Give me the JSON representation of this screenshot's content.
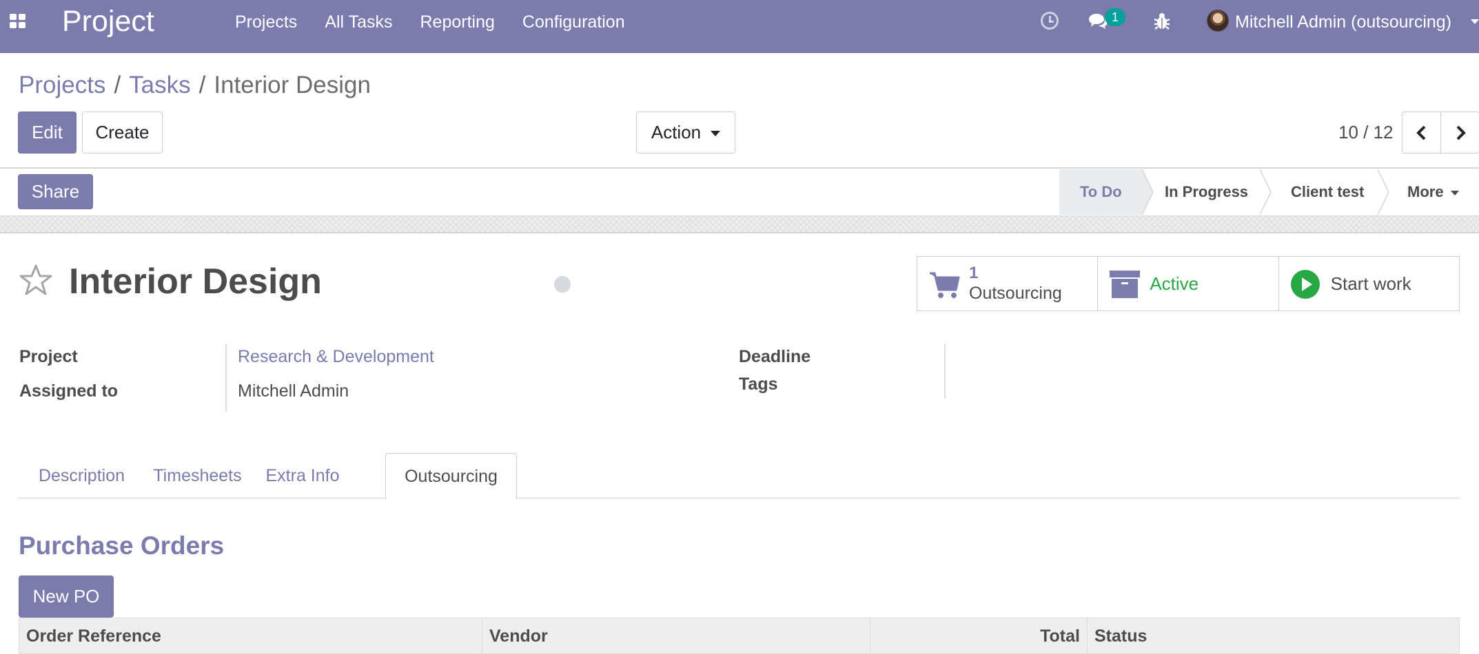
{
  "navbar": {
    "brand": "Project",
    "menu": [
      "Projects",
      "All Tasks",
      "Reporting",
      "Configuration"
    ],
    "chat_count": "1",
    "user": "Mitchell Admin (outsourcing)",
    "icons": [
      "apps-icon",
      "clock-icon",
      "chat-icon",
      "bug-icon",
      "avatar",
      "chevron-down-icon"
    ]
  },
  "breadcrumb": {
    "items": [
      "Projects",
      "Tasks"
    ],
    "current": "Interior Design",
    "separator": "/"
  },
  "toolbar": {
    "edit": "Edit",
    "create": "Create",
    "action": "Action"
  },
  "pager": {
    "value": "10 / 12"
  },
  "statusbar": {
    "share": "Share",
    "stages": [
      "To Do",
      "In Progress",
      "Client test"
    ],
    "more": "More",
    "active_stage": "To Do"
  },
  "task": {
    "title": "Interior Design",
    "stats": {
      "outsourcing_count": "1",
      "outsourcing_label": "Outsourcing",
      "active_label": "Active",
      "start_label": "Start work"
    },
    "fields": {
      "project_label": "Project",
      "project_value": "Research & Development",
      "assigned_label": "Assigned to",
      "assigned_value": "Mitchell Admin",
      "deadline_label": "Deadline",
      "tags_label": "Tags"
    }
  },
  "tabs": [
    "Description",
    "Timesheets",
    "Extra Info",
    "Outsourcing"
  ],
  "active_tab": "Outsourcing",
  "purchase_orders": {
    "title": "Purchase Orders",
    "new_button": "New PO",
    "columns": [
      "Order Reference",
      "Vendor",
      "Total",
      "Status"
    ]
  },
  "colors": {
    "brand": "#7c7bad",
    "active_green": "#28a745",
    "badge_teal": "#00a09d"
  }
}
